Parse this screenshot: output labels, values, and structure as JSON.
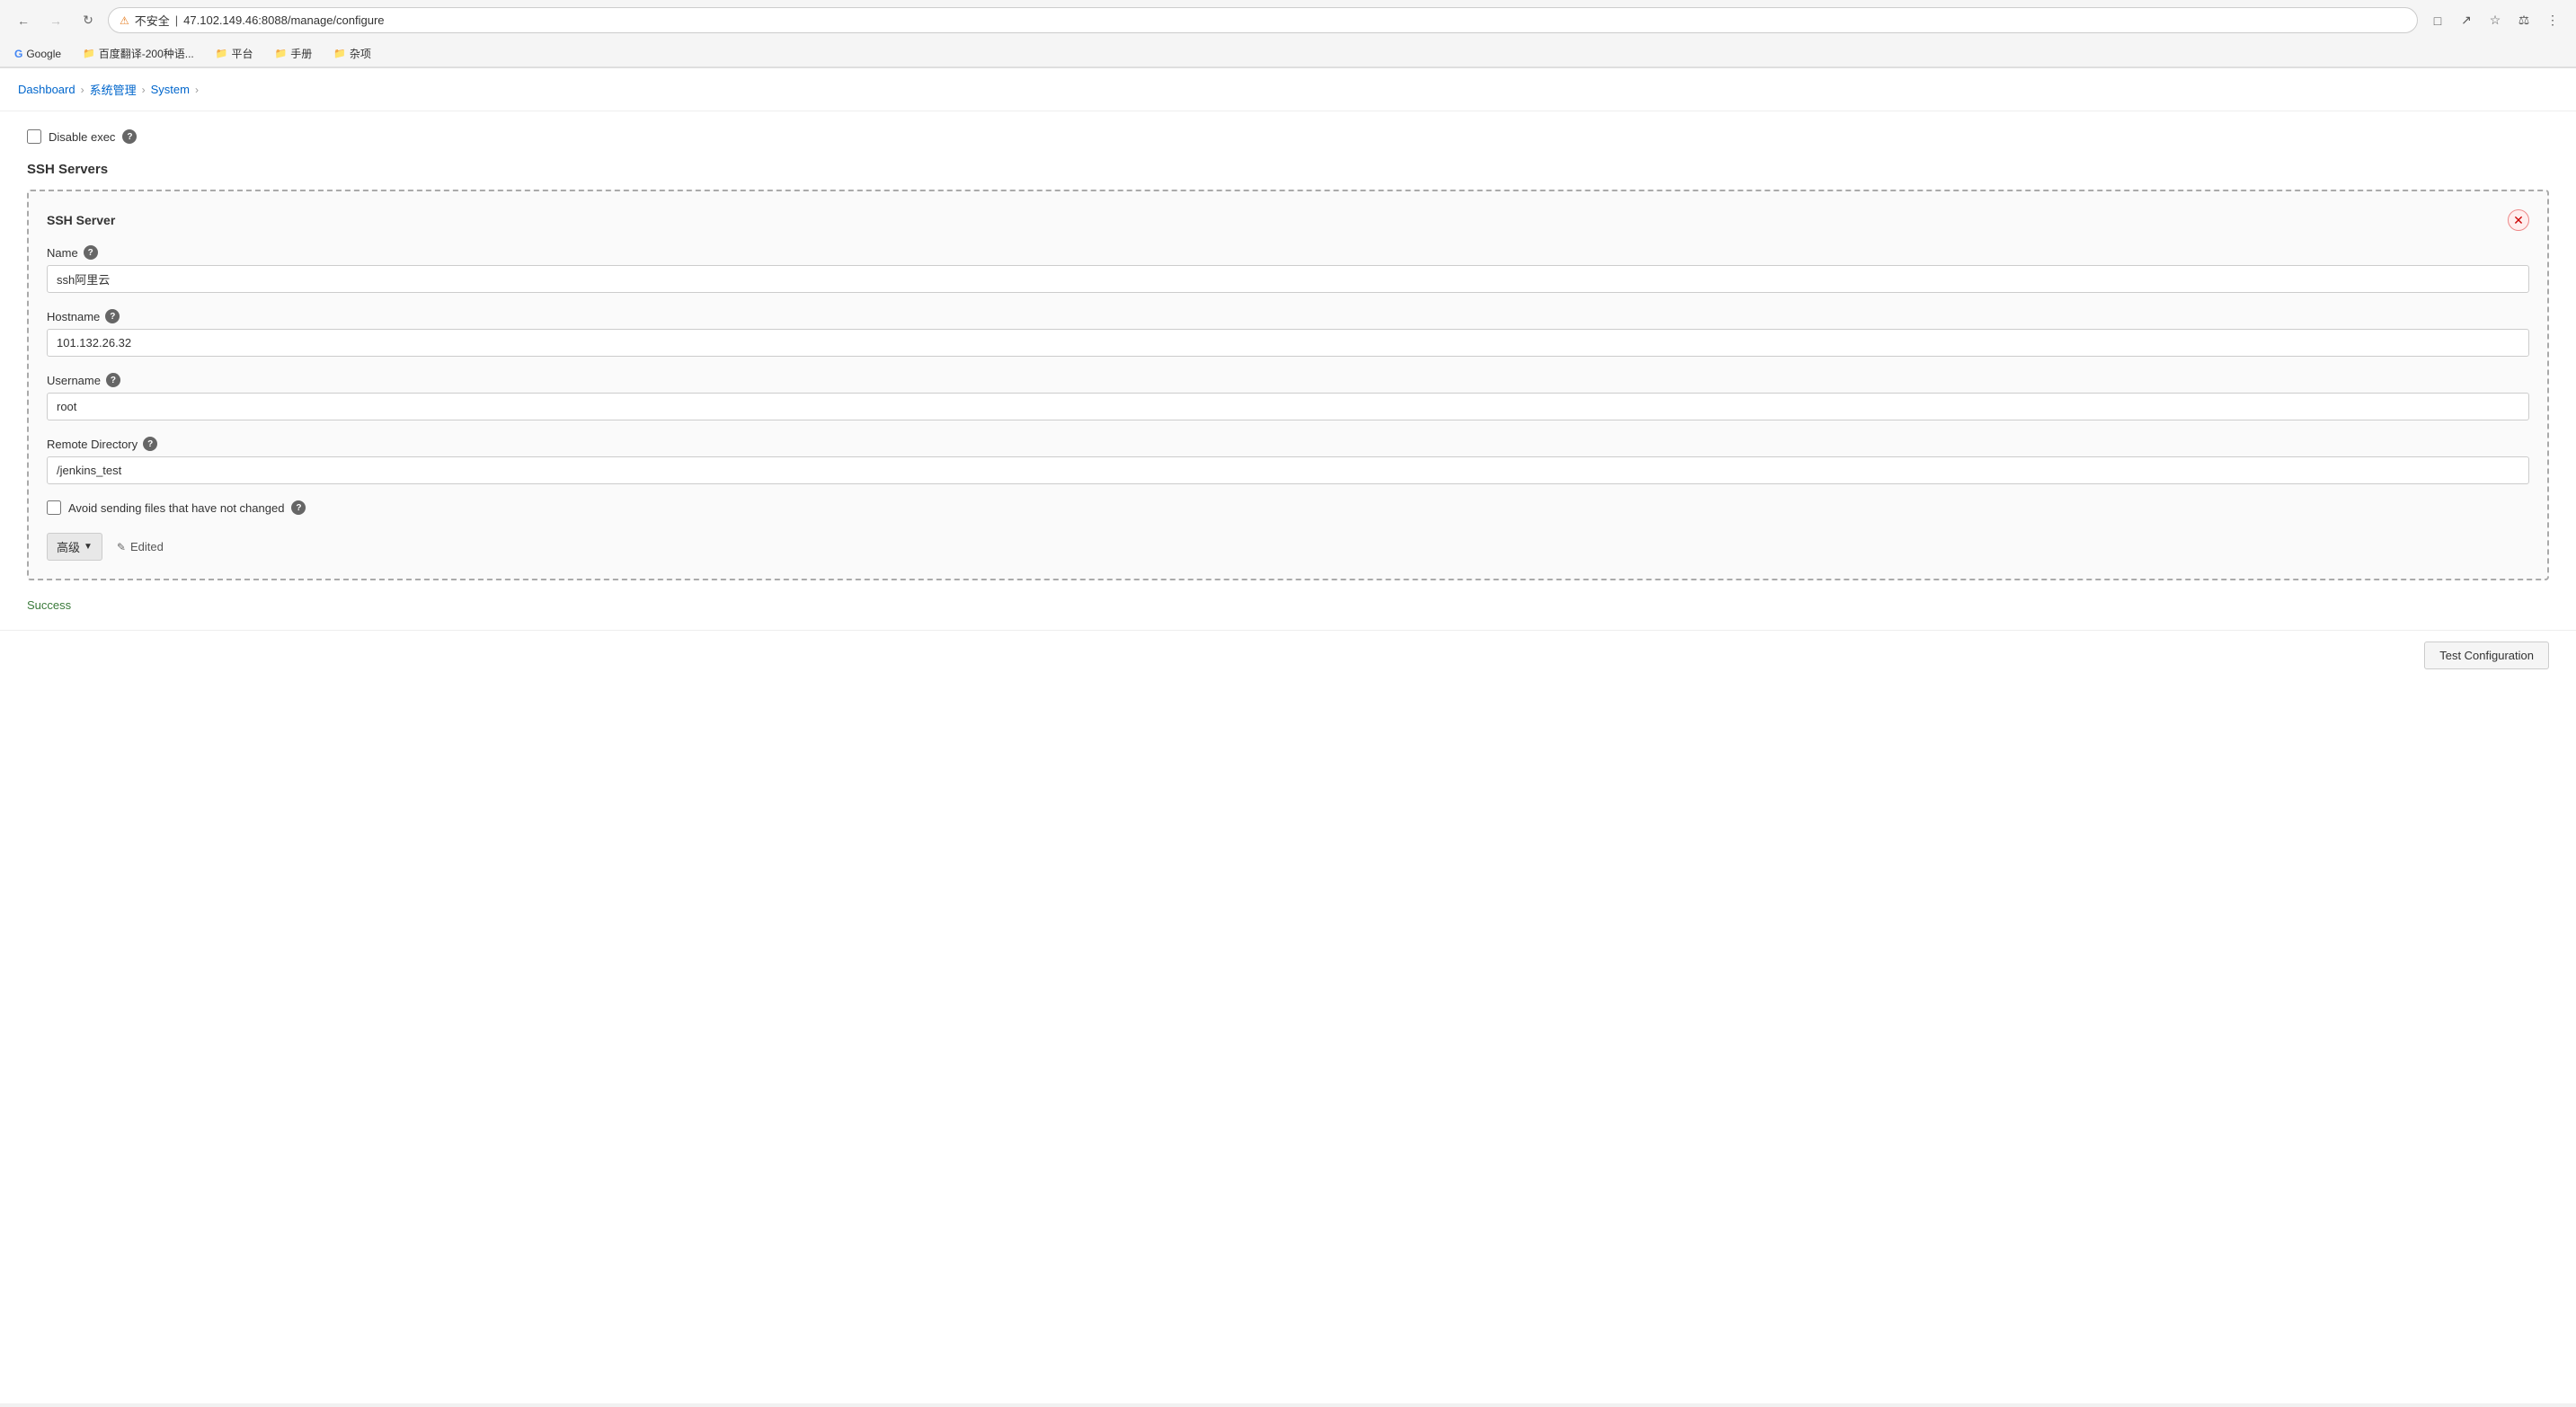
{
  "browser": {
    "url": "47.102.149.46:8088/manage/configure",
    "warning_text": "不安全",
    "back_disabled": false,
    "forward_disabled": true
  },
  "bookmarks": [
    {
      "id": "google",
      "label": "Google",
      "icon": "G"
    },
    {
      "id": "baidu-translate",
      "label": "百度翻译-200种语...",
      "icon": "📁"
    },
    {
      "id": "platform",
      "label": "平台",
      "icon": "📁"
    },
    {
      "id": "manual",
      "label": "手册",
      "icon": "📁"
    },
    {
      "id": "misc",
      "label": "杂项",
      "icon": "📁"
    }
  ],
  "breadcrumb": {
    "items": [
      "Dashboard",
      "系统管理",
      "System"
    ],
    "separators": [
      "›",
      "›",
      "›"
    ]
  },
  "page": {
    "disable_exec_label": "Disable exec",
    "ssh_servers_title": "SSH Servers",
    "ssh_server": {
      "title": "SSH Server",
      "name_label": "Name",
      "name_value": "ssh阿里云",
      "hostname_label": "Hostname",
      "hostname_value": "101.132.26.32",
      "username_label": "Username",
      "username_value": "root",
      "remote_directory_label": "Remote Directory",
      "remote_directory_value": "/jenkins_test",
      "avoid_sending_label": "Avoid sending files that have not changed",
      "advanced_label": "高级",
      "edited_label": "Edited",
      "success_label": "Success",
      "test_config_label": "Test Configuration"
    }
  }
}
